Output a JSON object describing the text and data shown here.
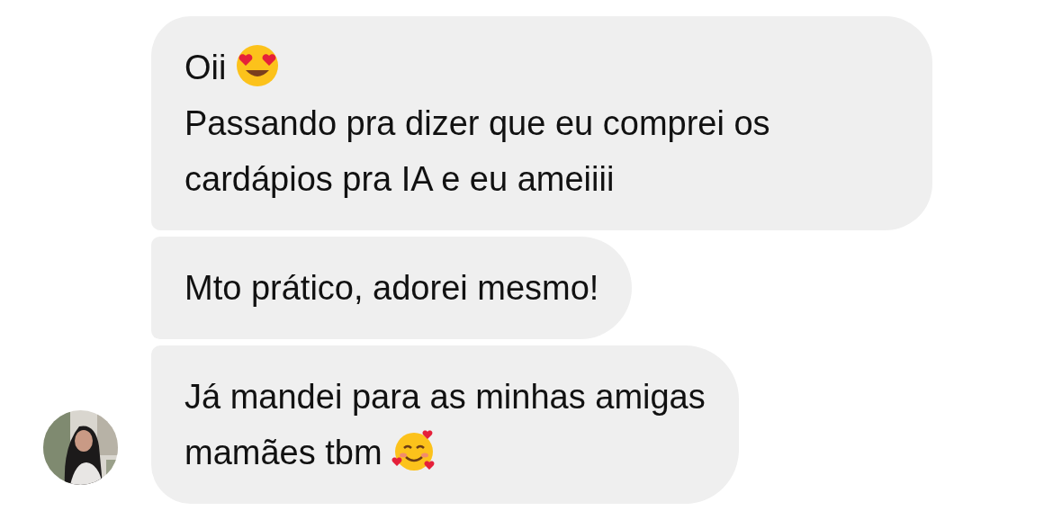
{
  "messages": [
    {
      "lines": [
        {
          "text": "Oii",
          "kind": "hearteyes"
        },
        {
          "text": "Passando pra dizer que eu comprei os cardápios pra IA e eu ameiiii",
          "kind": "plain"
        }
      ]
    },
    {
      "lines": [
        {
          "text": "Mto prático, adorei mesmo!",
          "kind": "plain"
        }
      ]
    },
    {
      "lines": [
        {
          "text": "Já mandei para as minhas amigas",
          "kind": "plain"
        },
        {
          "text": "mamães tbm",
          "kind": "hearts"
        }
      ]
    }
  ]
}
